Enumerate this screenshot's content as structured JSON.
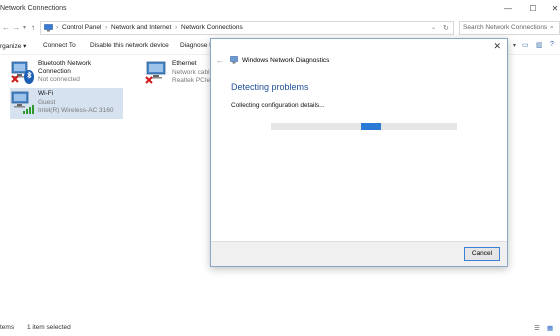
{
  "window": {
    "title": "Network Connections",
    "controls": {
      "minimize": "—",
      "maximize": "☐",
      "close": "✕"
    }
  },
  "address": {
    "crumbs": [
      "Control Panel",
      "Network and Internet",
      "Network Connections"
    ],
    "search_placeholder": "Search Network Connections"
  },
  "toolbar": {
    "organize": "rganize ▾",
    "connect": "Connect To",
    "disable": "Disable this network device",
    "diagnose": "Diagnose th"
  },
  "adapters": [
    {
      "name": "Bluetooth Network",
      "name2": "Connection",
      "status": "Not connected",
      "device": "",
      "icon": "bluetooth-network-icon",
      "state": "disconnected"
    },
    {
      "name": "Ethernet",
      "name2": "",
      "status": "Network cable",
      "device": "Realtek PCIe G",
      "icon": "ethernet-network-icon",
      "state": "disconnected"
    },
    {
      "name": "Wi-Fi",
      "name2": "",
      "status": "Guest",
      "device": "Intel(R) Wireless-AC 3160",
      "icon": "wifi-network-icon",
      "state": "connected"
    }
  ],
  "statusbar": {
    "items": "tems",
    "selected": "1 item selected"
  },
  "dialog": {
    "title": "Windows Network Diagnostics",
    "heading": "Detecting problems",
    "status": "Collecting configuration details...",
    "progress_fraction": 0.54,
    "cancel_label": "Cancel"
  },
  "colors": {
    "accent": "#1e4f9a",
    "progress": "#2a7ad5",
    "selection": "#d6e2f0",
    "error": "#d21919"
  }
}
